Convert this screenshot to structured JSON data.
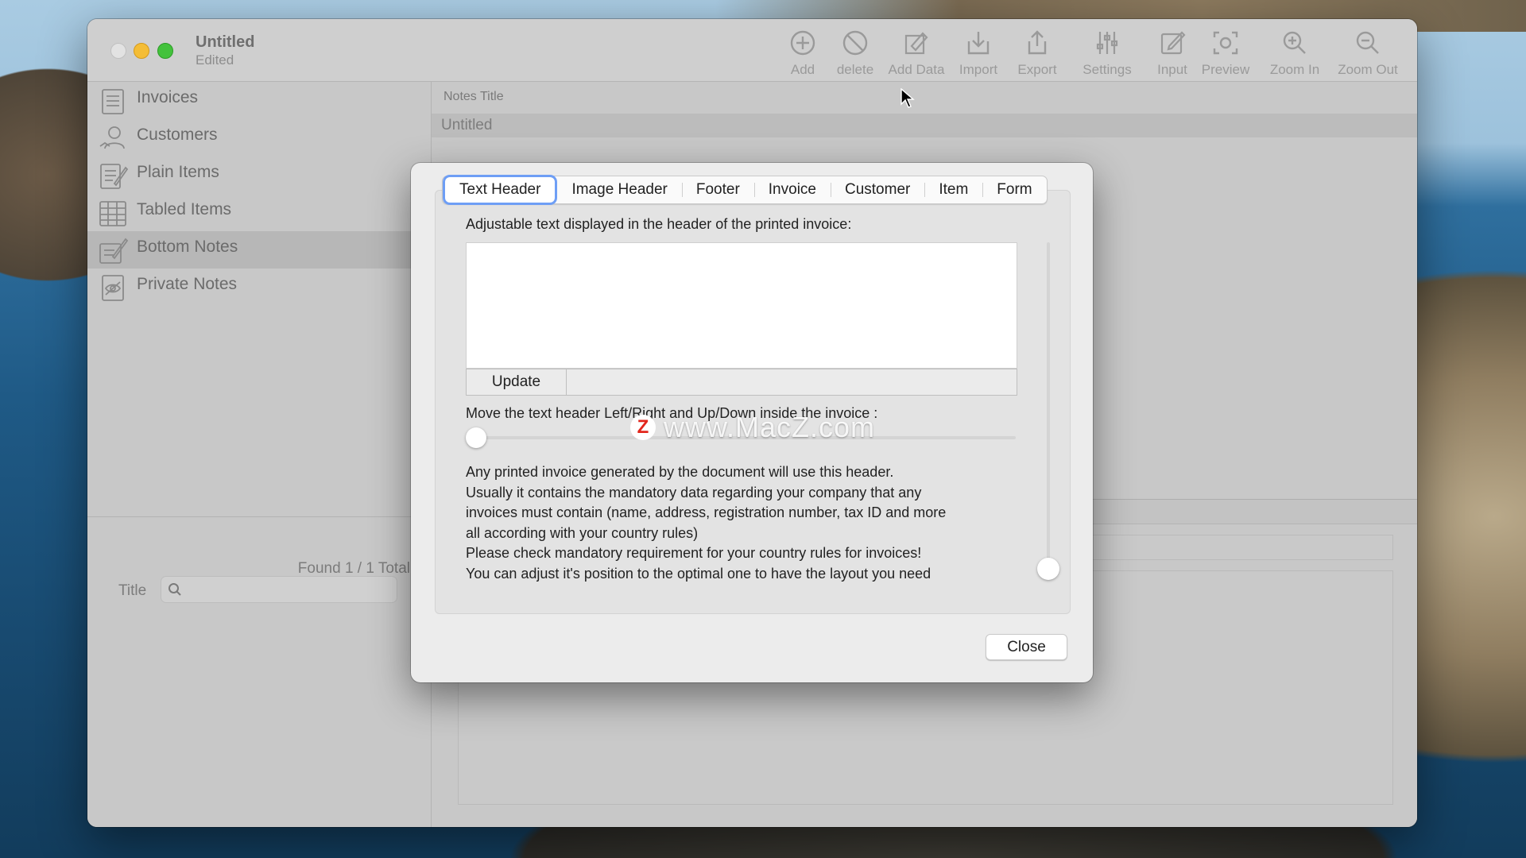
{
  "window": {
    "title": "Untitled",
    "subtitle": "Edited"
  },
  "toolbar": [
    {
      "label": "Add",
      "icon": "plus-circle-icon"
    },
    {
      "label": "delete",
      "icon": "prohibit-icon"
    },
    {
      "label": "Add Data",
      "icon": "add-data-icon"
    },
    {
      "label": "Import",
      "icon": "import-icon"
    },
    {
      "label": "Export",
      "icon": "export-icon"
    },
    {
      "label": "Settings",
      "icon": "sliders-icon"
    },
    {
      "label": "Input",
      "icon": "pencil-square-icon"
    },
    {
      "label": "Preview",
      "icon": "eye-preview-icon"
    },
    {
      "label": "Zoom In",
      "icon": "zoom-in-icon"
    },
    {
      "label": "Zoom Out",
      "icon": "zoom-out-icon"
    }
  ],
  "sidebar": {
    "items": [
      {
        "label": "Invoices",
        "icon": "invoice-icon"
      },
      {
        "label": "Customers",
        "icon": "customers-icon"
      },
      {
        "label": "Plain Items",
        "icon": "plain-items-icon"
      },
      {
        "label": "Tabled Items",
        "icon": "table-icon"
      },
      {
        "label": "Bottom Notes",
        "icon": "bottom-notes-icon",
        "selected": true
      },
      {
        "label": "Private Notes",
        "icon": "private-notes-icon"
      }
    ],
    "found": "Found 1 / 1 Total",
    "search_label": "Title",
    "search_value": ""
  },
  "main": {
    "column_header": "Notes Title",
    "rows": [
      "Untitled"
    ]
  },
  "dialog": {
    "tabs": [
      "Text Header",
      "Image Header",
      "Footer",
      "Invoice",
      "Customer",
      "Item",
      "Form"
    ],
    "active_tab": "Text Header",
    "header_label": "Adjustable text displayed in the header of the printed invoice:",
    "header_text": "",
    "update_label": "Update",
    "move_label": "Move the text header Left/Right and Up/Down inside the invoice :",
    "horizontal_position": 0,
    "vertical_position": 1,
    "info_lines": [
      "Any printed invoice generated by  the document will use this header.",
      "Usually it contains the mandatory data regarding your company that any",
      "invoices must contain (name, address, registration number, tax ID and more",
      "all according with your country rules)",
      "Please check mandatory requirement for your country rules for invoices!",
      "You can adjust it's position to the optimal one to have the layout you need"
    ],
    "close_label": "Close"
  },
  "watermark": {
    "logo": "Z",
    "text": "www.MacZ.com"
  }
}
